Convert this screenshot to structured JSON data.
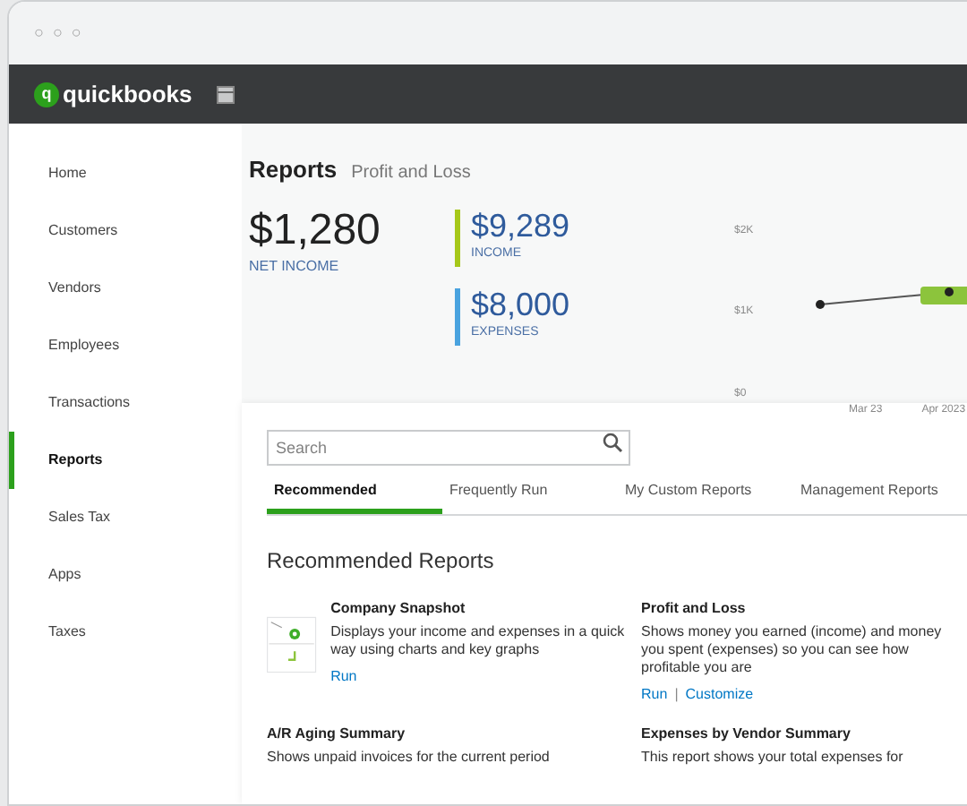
{
  "window": {
    "controls": [
      "○",
      "○",
      "○"
    ]
  },
  "app_bar": {
    "logo_mark": "q",
    "logo_text": "quickbooks"
  },
  "sidebar": {
    "items": [
      {
        "label": "Home",
        "selected": false
      },
      {
        "label": "Customers",
        "selected": false
      },
      {
        "label": "Vendors",
        "selected": false
      },
      {
        "label": "Employees",
        "selected": false
      },
      {
        "label": "Transactions",
        "selected": false
      },
      {
        "label": "Reports",
        "selected": true
      },
      {
        "label": "Sales Tax",
        "selected": false
      },
      {
        "label": "Apps",
        "selected": false
      },
      {
        "label": "Taxes",
        "selected": false
      }
    ]
  },
  "header": {
    "title": "Reports",
    "subtitle": "Profit and Loss"
  },
  "summary": {
    "main": {
      "value": "$1,280",
      "label": "NET INCOME"
    },
    "stats": [
      {
        "value": "$9,289",
        "label": "INCOME",
        "color": "#a6c81a"
      },
      {
        "value": "$8,000",
        "label": "EXPENSES",
        "color": "#4aa3df"
      }
    ]
  },
  "trend": {
    "y_labels": [
      "$2K",
      "$1K",
      "$0"
    ],
    "x_labels": [
      "Mar 23",
      "Apr 2023"
    ]
  },
  "search": {
    "placeholder": "Search"
  },
  "tabs": [
    {
      "label": "Recommended",
      "selected": true
    },
    {
      "label": "Frequently Run",
      "selected": false
    },
    {
      "label": "My Custom Reports",
      "selected": false
    },
    {
      "label": "Management Reports",
      "selected": false
    }
  ],
  "section_title": "Recommended Reports",
  "reports": [
    {
      "title": "Company Snapshot",
      "description": "Displays your income and expenses in a quick way using charts and key graphs",
      "links": [
        "Run"
      ],
      "kind": "thumbnail"
    },
    {
      "title": "Profit and Loss",
      "description": "Shows money you earned (income) and money you spent (expenses) so you can see how profitable you are",
      "links": [
        "Run",
        "Customize"
      ],
      "link_separator": "|",
      "kind": "plain"
    },
    {
      "title": "A/R Aging Summary",
      "description": "Shows unpaid invoices for the current period",
      "kind": "plain"
    },
    {
      "title": "Expenses by Vendor Summary",
      "description": "This report shows your total expenses for",
      "kind": "plain"
    }
  ]
}
